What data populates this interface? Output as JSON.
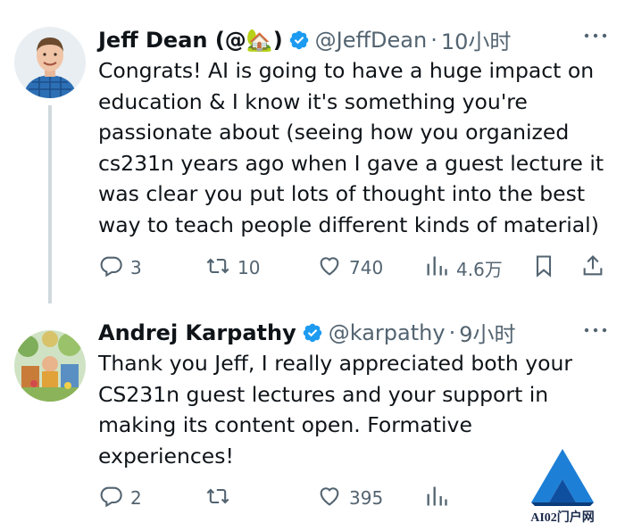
{
  "tweets": [
    {
      "name": "Jeff Dean (@🏡)",
      "handle": "@JeffDean",
      "separator": "·",
      "time": "10小时",
      "text": "Congrats! AI is going to have a huge impact on education & I know it's something you're passionate about (seeing how you organized cs231n years ago when I gave a guest lecture it was clear you put lots of thought into the best way to teach people different kinds of material)",
      "replies": "3",
      "retweets": "10",
      "likes": "740",
      "views": "4.6万"
    },
    {
      "name": "Andrej Karpathy",
      "handle": "@karpathy",
      "separator": "·",
      "time": "9小时",
      "text": "Thank you Jeff, I really appreciated both your CS231n guest lectures and your support in making its content open. Formative experiences!",
      "replies": "2",
      "retweets": "",
      "likes": "395",
      "views": ""
    }
  ],
  "icons": {
    "verified": "verified-badge-icon",
    "more": "more-options-icon",
    "reply": "reply-icon",
    "retweet": "retweet-icon",
    "like": "like-icon",
    "views": "views-icon",
    "bookmark": "bookmark-icon",
    "share": "share-icon"
  },
  "colors": {
    "verified": "#1d9bf0",
    "secondary_text": "#536471",
    "primary_text": "#0f1419",
    "thread_line": "#cfd9de"
  },
  "watermark": {
    "text": "AI02门户网"
  }
}
